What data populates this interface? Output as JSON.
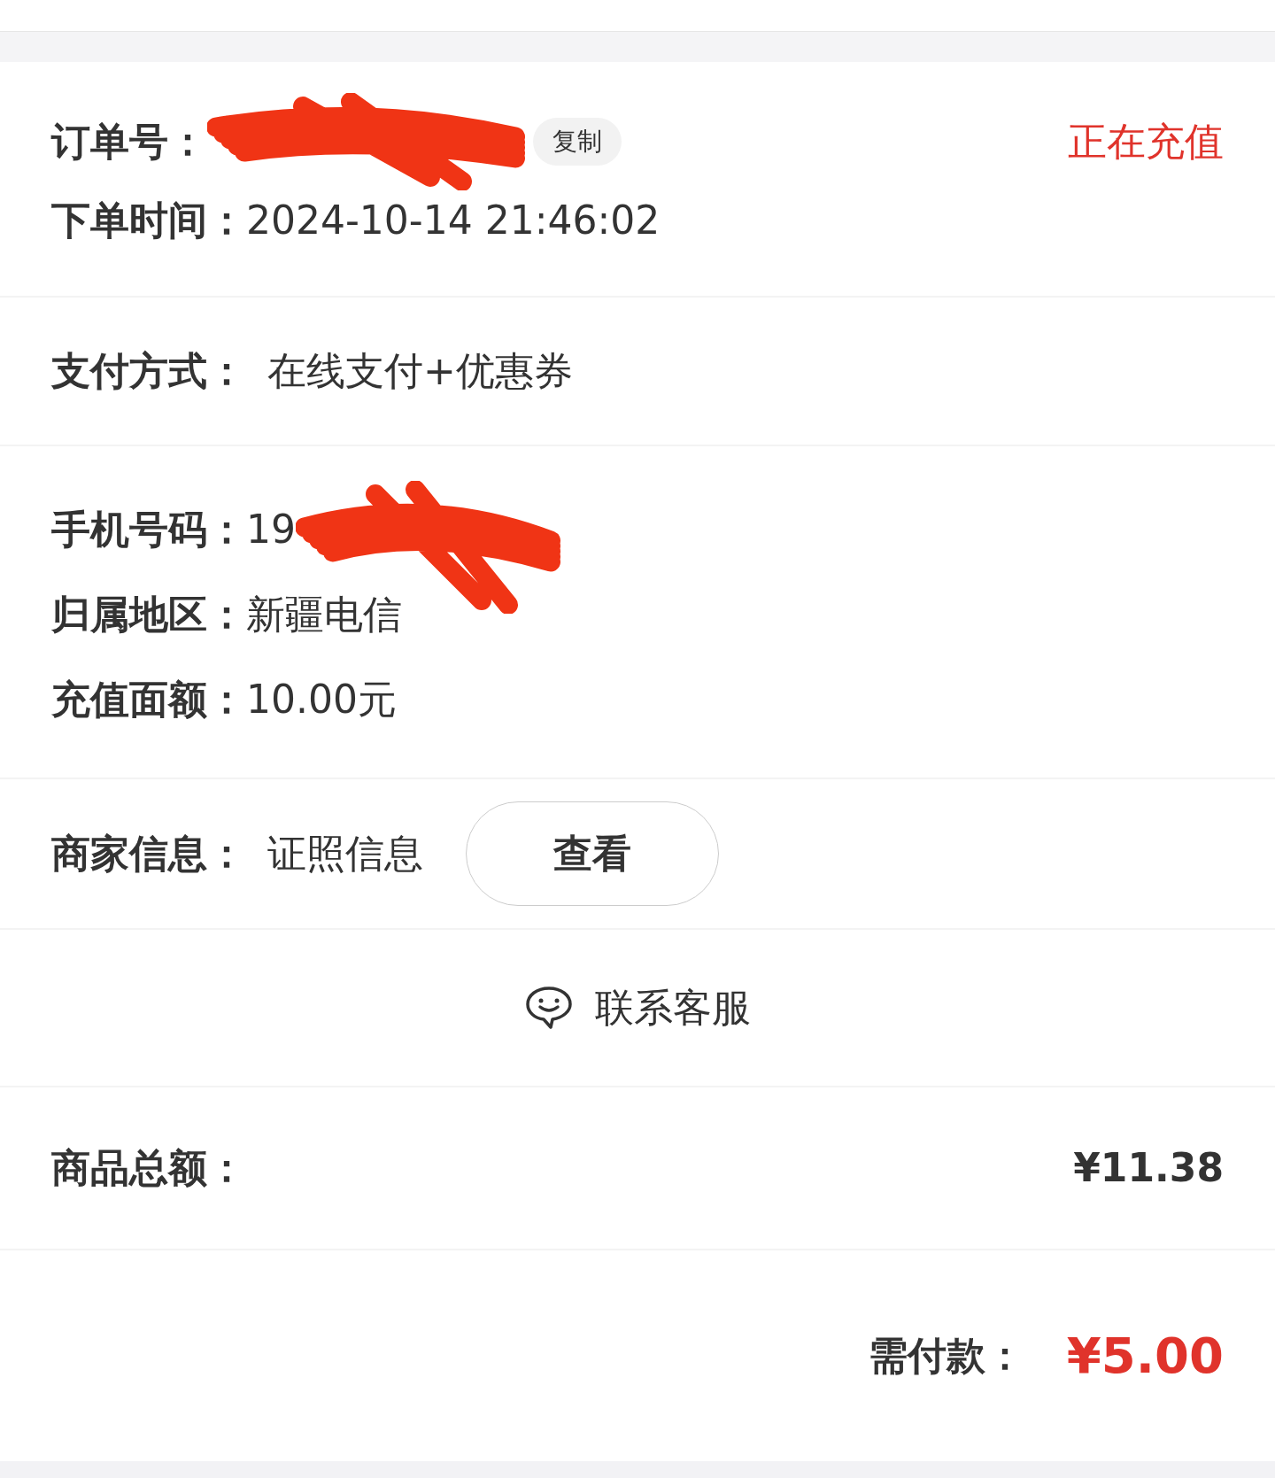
{
  "order": {
    "label": "订单号：",
    "copy_button": "复制",
    "status": "正在充值",
    "time_label": "下单时间：",
    "time": "2024-10-14 21:46:02"
  },
  "payment": {
    "label": "支付方式：",
    "value": "在线支付+优惠券"
  },
  "recharge": [
    {
      "label": "手机号码：",
      "value": "19",
      "redacted": true
    },
    {
      "label": "归属地区：",
      "value": "新疆电信",
      "redacted": false
    },
    {
      "label": "充值面额：",
      "value": "10.00元",
      "redacted": false
    }
  ],
  "merchant": {
    "label": "商家信息：",
    "value": "证照信息",
    "button": "查看"
  },
  "service": {
    "label": "联系客服"
  },
  "total": {
    "label": "商品总额：",
    "value": "¥11.38"
  },
  "due": {
    "label": "需付款：",
    "value": "¥5.00"
  }
}
